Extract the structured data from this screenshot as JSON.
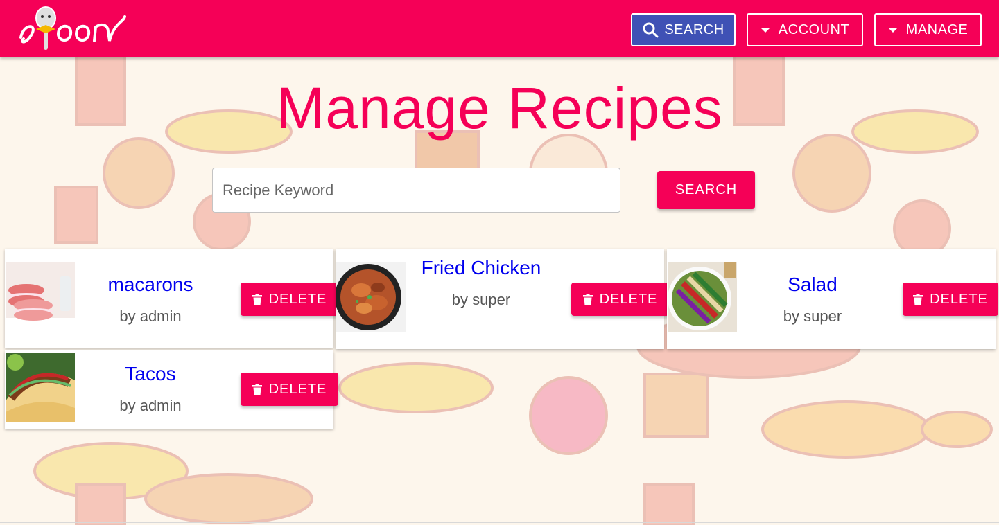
{
  "header": {
    "logo_text": "spoon",
    "nav": {
      "search_label": "SEARCH",
      "account_label": "ACCOUNT",
      "manage_label": "MANAGE"
    }
  },
  "main": {
    "title": "Manage Recipes",
    "search": {
      "placeholder": "Recipe Keyword",
      "value": "",
      "button_label": "SEARCH"
    },
    "recipes": [
      {
        "title": "macarons",
        "author": "by admin",
        "delete_label": "DELETE"
      },
      {
        "title": "Fried Chicken",
        "author": "by super",
        "delete_label": "DELETE"
      },
      {
        "title": "Salad",
        "author": "by super",
        "delete_label": "DELETE"
      },
      {
        "title": "Tacos",
        "author": "by admin",
        "delete_label": "DELETE"
      }
    ]
  },
  "colors": {
    "brand": "#f50057",
    "search_nav": "#3f51b5",
    "link": "#0000ee"
  }
}
